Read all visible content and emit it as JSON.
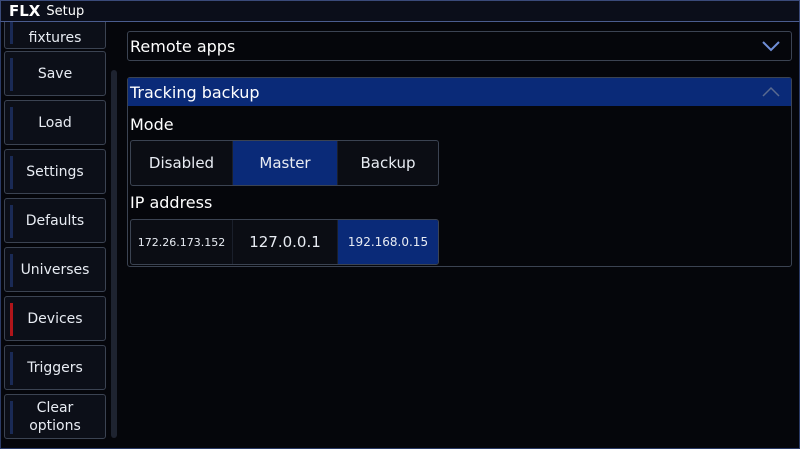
{
  "titlebar": {
    "logo": "FLX",
    "title": "Setup"
  },
  "sidebar": {
    "items": [
      {
        "label": "fixtures",
        "active": false
      },
      {
        "label": "Save",
        "active": false
      },
      {
        "label": "Load",
        "active": false
      },
      {
        "label": "Settings",
        "active": false
      },
      {
        "label": "Defaults",
        "active": false
      },
      {
        "label": "Universes",
        "active": false
      },
      {
        "label": "Devices",
        "active": true
      },
      {
        "label": "Triggers",
        "active": false
      },
      {
        "label": "Clear\noptions",
        "active": false
      }
    ]
  },
  "sections": {
    "remote_apps": {
      "title": "Remote apps",
      "icon": "chevron-down-icon",
      "expanded": false
    },
    "tracking_backup": {
      "title": "Tracking backup",
      "icon": "chevron-up-icon",
      "expanded": true,
      "mode_label": "Mode",
      "mode_options": [
        "Disabled",
        "Master",
        "Backup"
      ],
      "mode_selected": "Master",
      "ip_label": "IP address",
      "ip_options": [
        "172.26.173.152",
        "127.0.0.1",
        "192.168.0.15"
      ],
      "ip_selected": "192.168.0.15"
    }
  },
  "colors": {
    "accent": "#0a2a78",
    "active_indicator": "#b0151a",
    "border": "#3b4352",
    "background": "#05060b"
  }
}
